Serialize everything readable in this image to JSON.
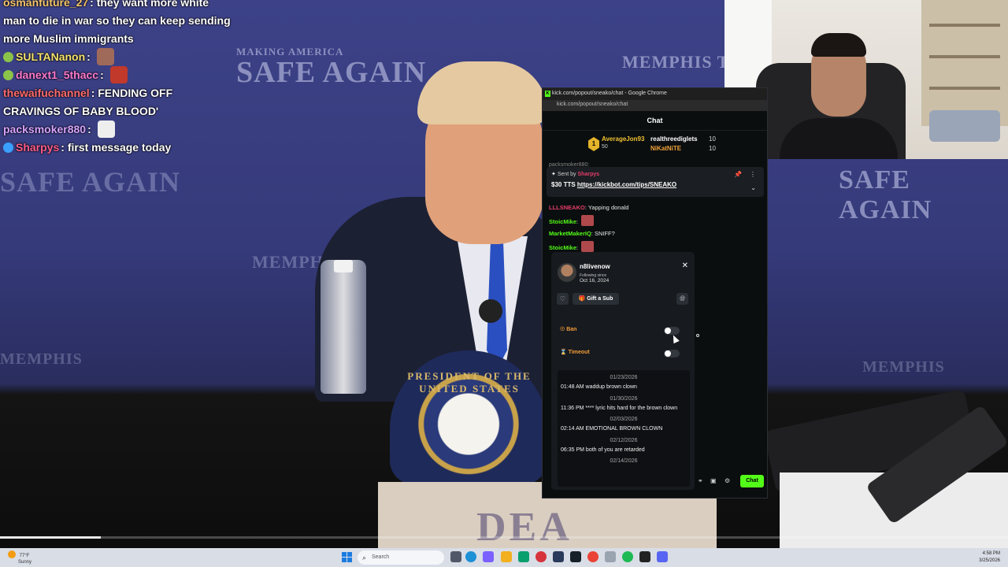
{
  "overlay_chat": [
    {
      "user": "osmanfuture_27",
      "user_color": "#f5c56b",
      "text": "they want more white man to die in war so they can keep sending more Muslim immigrants",
      "badge_color": "",
      "emote": false
    },
    {
      "user": "SULTANanon",
      "user_color": "#f5e36b",
      "text": "",
      "badge_color": "#8bc34a",
      "emote": true
    },
    {
      "user": "danext1_5thacc",
      "user_color": "#ff7ad1",
      "text": "",
      "badge_color": "#8bc34a",
      "emote": true
    },
    {
      "user": "thewaifuchannel",
      "user_color": "#ff6b6b",
      "text": "FENDING OFF CRAVINGS OF BABY BLOOD'",
      "badge_color": "",
      "emote": false
    },
    {
      "user": "packsmoker880",
      "user_color": "#d6a3ff",
      "text": "",
      "badge_color": "",
      "emote": true
    },
    {
      "user": "Sharpys",
      "user_color": "#ff5c8a",
      "text": "first message today",
      "badge_color": "#3aa0ff",
      "emote": false
    }
  ],
  "backdrop": {
    "line1": "MAKING AMERICA",
    "line2": "SAFE AGAIN",
    "left": "SAFE AGAIN",
    "right_top": "MEMPHIS TENNESSEE",
    "right_mid": "SAFE AGAIN",
    "mid": "MEMPHIS TENNESSEE",
    "right_low": "MEMPHIS",
    "left_low": "MEMPHIS"
  },
  "seal_text": "PRESIDENT OF THE UNITED STATES",
  "podium_text": "DEA",
  "popout": {
    "window_title": "kick.com/popout/sneako/chat - Google Chrome",
    "url": "kick.com/popout/sneako/chat",
    "header": "Chat",
    "top_gifter": {
      "name": "AverageJon93",
      "count": "50",
      "rank": "1"
    },
    "gifters": [
      {
        "name": "realthreediglets",
        "count": "10"
      },
      {
        "name": "NiKatNiTE",
        "count": "10"
      }
    ],
    "faded_row": "packsmoker880:",
    "pinned": {
      "sent_by_label": "Sent by",
      "sender": "Sharpys",
      "amount": "$30 TTS",
      "link": "https://kickbot.com/tips/SNEAKO"
    },
    "messages": [
      {
        "user": "LLLSNEAKO",
        "color": "#e53d6a",
        "text": "Yapping donald",
        "emote": false
      },
      {
        "user": "StoicMike",
        "color": "#53fc18",
        "text": "",
        "emote": true
      },
      {
        "user": "MarketMakerIQ",
        "color": "#53fc18",
        "text": "SNIFF?",
        "emote": false
      },
      {
        "user": "StoicMike",
        "color": "#53fc18",
        "text": "",
        "emote": true
      }
    ],
    "usercard": {
      "username": "n8livenow",
      "following_label": "Following since",
      "following_date": "Oct 16, 2024",
      "gift_label": "Gift a Sub",
      "ban_label": "Ban",
      "timeout_label": "Timeout",
      "history": [
        {
          "date": "01/23/2026",
          "time": "01:48 AM",
          "text": "waddup brown clown"
        },
        {
          "date": "01/30/2026",
          "time": "11:36 PM",
          "text": "**** lyric hits hard for the brown clown"
        },
        {
          "date": "02/03/2026",
          "time": "02:14 AM",
          "text": "EMOTIONAL BROWN CLOWN"
        },
        {
          "date": "02/12/2026",
          "time": "06:35 PM",
          "text": "both of you are retarded"
        },
        {
          "date": "02/14/2026",
          "time": "",
          "text": ""
        }
      ]
    },
    "chat_button": "Chat"
  },
  "video_progress": 0.1,
  "taskbar": {
    "weather_temp": "77°F",
    "weather_desc": "Sunny",
    "search_placeholder": "Search",
    "time": "4:58 PM",
    "date": "3/25/2026"
  }
}
